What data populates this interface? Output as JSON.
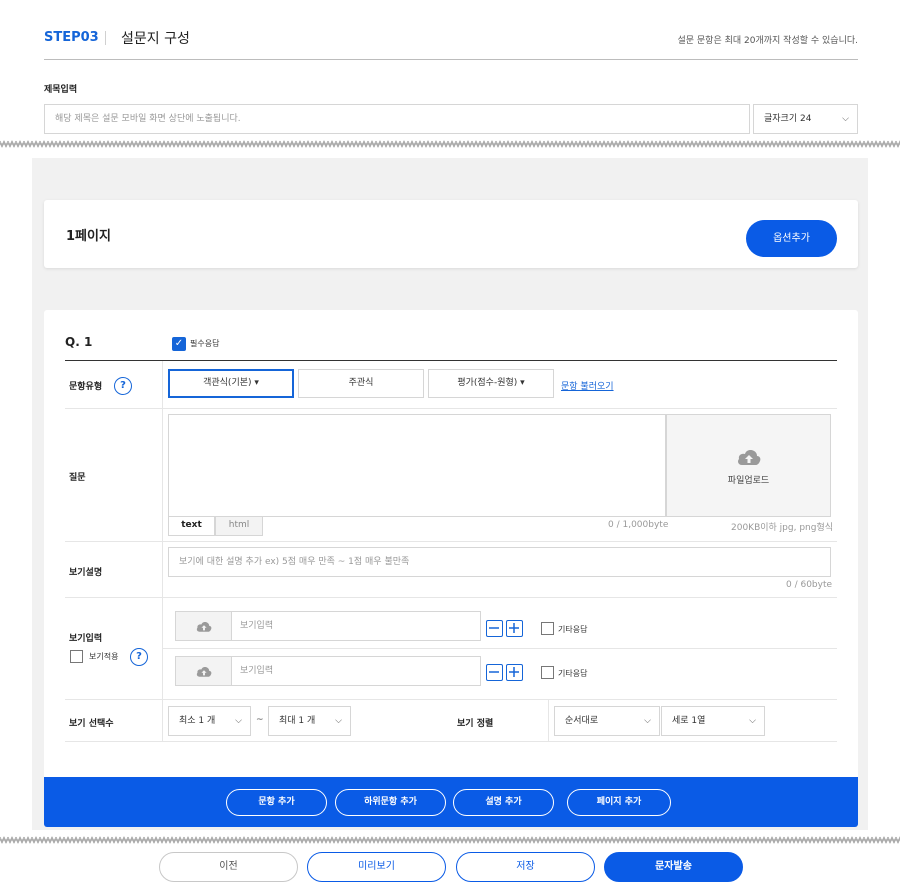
{
  "header": {
    "step": "STEP03",
    "title": "설문지 구성",
    "note": "설문 문항은 최대 20개까지 작성할 수 있습니다."
  },
  "title_section": {
    "label": "제목입력",
    "placeholder": "해당 제목은 설문 모바일 화면 상단에 노출됩니다.",
    "font_size_select": "글자크기 24"
  },
  "page_card": {
    "title": "1페이지",
    "add_option_button": "옵션추가"
  },
  "question": {
    "number": "Q. 1",
    "required_label": "필수응답",
    "required_checked": true,
    "type_row": {
      "label": "문항유형",
      "help": "?",
      "types": [
        "객관식(기본) ▾",
        "주관식",
        "평가(점수-원형) ▾"
      ],
      "active_type": "객관식(기본) ▾",
      "load_link": "문항 불러오기"
    },
    "question_row": {
      "label": "질문",
      "tabs": [
        "text",
        "html"
      ],
      "byte_count": "0 / 1,000byte",
      "upload_label": "파일업로드",
      "upload_note": "200KB이하 jpg, png형식"
    },
    "desc_row": {
      "label": "보기설명",
      "placeholder": "보기에 대한 설명 추가 ex) 5점 매우 만족 ~ 1점 매우 불만족",
      "byte_count": "0 / 60byte"
    },
    "options_row": {
      "label": "보기입력",
      "apply_label": "보기적용",
      "help": "?",
      "items": [
        {
          "placeholder": "보기입력",
          "etc_label": "기타응답"
        },
        {
          "placeholder": "보기입력",
          "etc_label": "기타응답"
        }
      ]
    },
    "select_count_row": {
      "label": "보기 선택수",
      "min": "최소 1 개",
      "tilde": "~",
      "max": "최대 1 개",
      "sort_label": "보기 정렬",
      "sort_order": "순서대로",
      "layout": "세로 1열"
    }
  },
  "bottom_bar": {
    "buttons": [
      "문항 추가",
      "하위문항 추가",
      "설명 추가",
      "페이지 추가"
    ]
  },
  "footer": {
    "buttons": [
      "이전",
      "미리보기",
      "저장",
      "문자발송"
    ]
  },
  "colors": {
    "accent": "#1565d8",
    "bar_blue": "#0a5be6",
    "panel_gray": "#f1f1f1"
  },
  "icons": [
    "cloud-upload-icon",
    "minus-icon",
    "plus-icon",
    "chevron-down-icon",
    "help-icon",
    "checkbox-icon"
  ]
}
